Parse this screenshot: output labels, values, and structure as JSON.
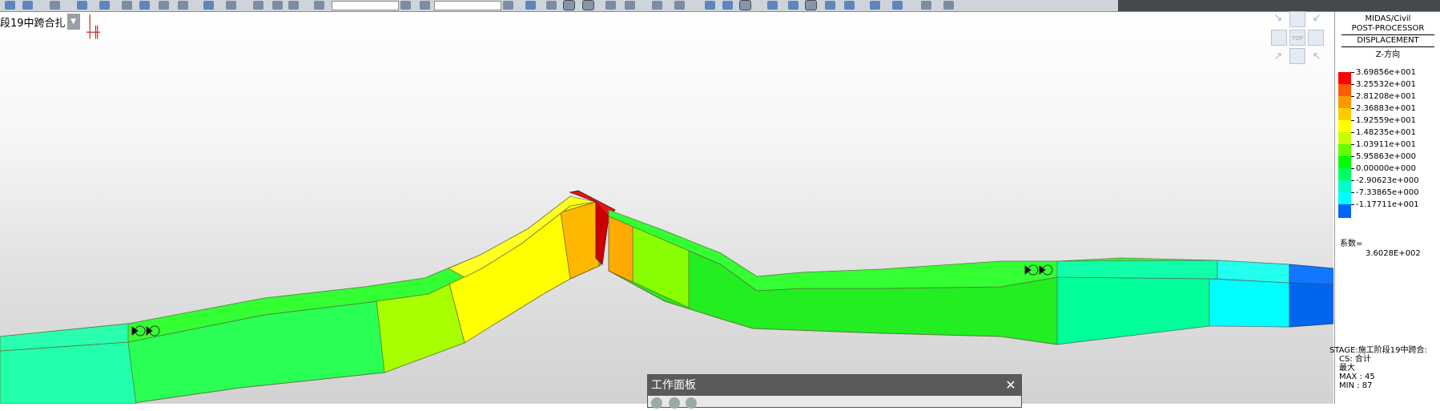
{
  "toolbar": {
    "icons": [
      "tool-icon"
    ]
  },
  "stage_combo": {
    "value": "段19中跨合扎",
    "dropdown_arrow": "▼"
  },
  "view_cube": {
    "top_label": "TOP"
  },
  "legend": {
    "title1": "MIDAS/Civil",
    "title2": "POST-PROCESSOR",
    "title3": "DISPLACEMENT",
    "direction": "Z-方向",
    "entries": [
      {
        "value": "3.69856e+001",
        "color": "#ff0000"
      },
      {
        "value": "3.25532e+001",
        "color": "#ff5a00"
      },
      {
        "value": "2.81208e+001",
        "color": "#ff9900"
      },
      {
        "value": "2.36883e+001",
        "color": "#ffcc00"
      },
      {
        "value": "1.92559e+001",
        "color": "#ffff00"
      },
      {
        "value": "1.48235e+001",
        "color": "#c8ff00"
      },
      {
        "value": "1.03911e+001",
        "color": "#64ff00"
      },
      {
        "value": "5.95863e+000",
        "color": "#00ff00"
      },
      {
        "value": "0.00000e+000",
        "color": "#00ff64"
      },
      {
        "value": "-2.90623e+000",
        "color": "#00ffc8"
      },
      {
        "value": "-7.33865e+000",
        "color": "#00ffff"
      },
      {
        "value": "-1.17711e+001",
        "color": "#0064ff"
      }
    ],
    "factor_label": "系数=",
    "factor_value": "3.6028E+002"
  },
  "stage_info": {
    "stage": "STAGE:施工阶段19中跨合:",
    "cs": "CS: 合计",
    "max_label": "最大",
    "max": "MAX : 45",
    "min": "MIN : 87"
  },
  "work_panel": {
    "title": "工作面板",
    "close": "✕"
  },
  "colors": {
    "toolbar_bg": "#cfd3da",
    "panel_title": "#5a5a5a"
  }
}
